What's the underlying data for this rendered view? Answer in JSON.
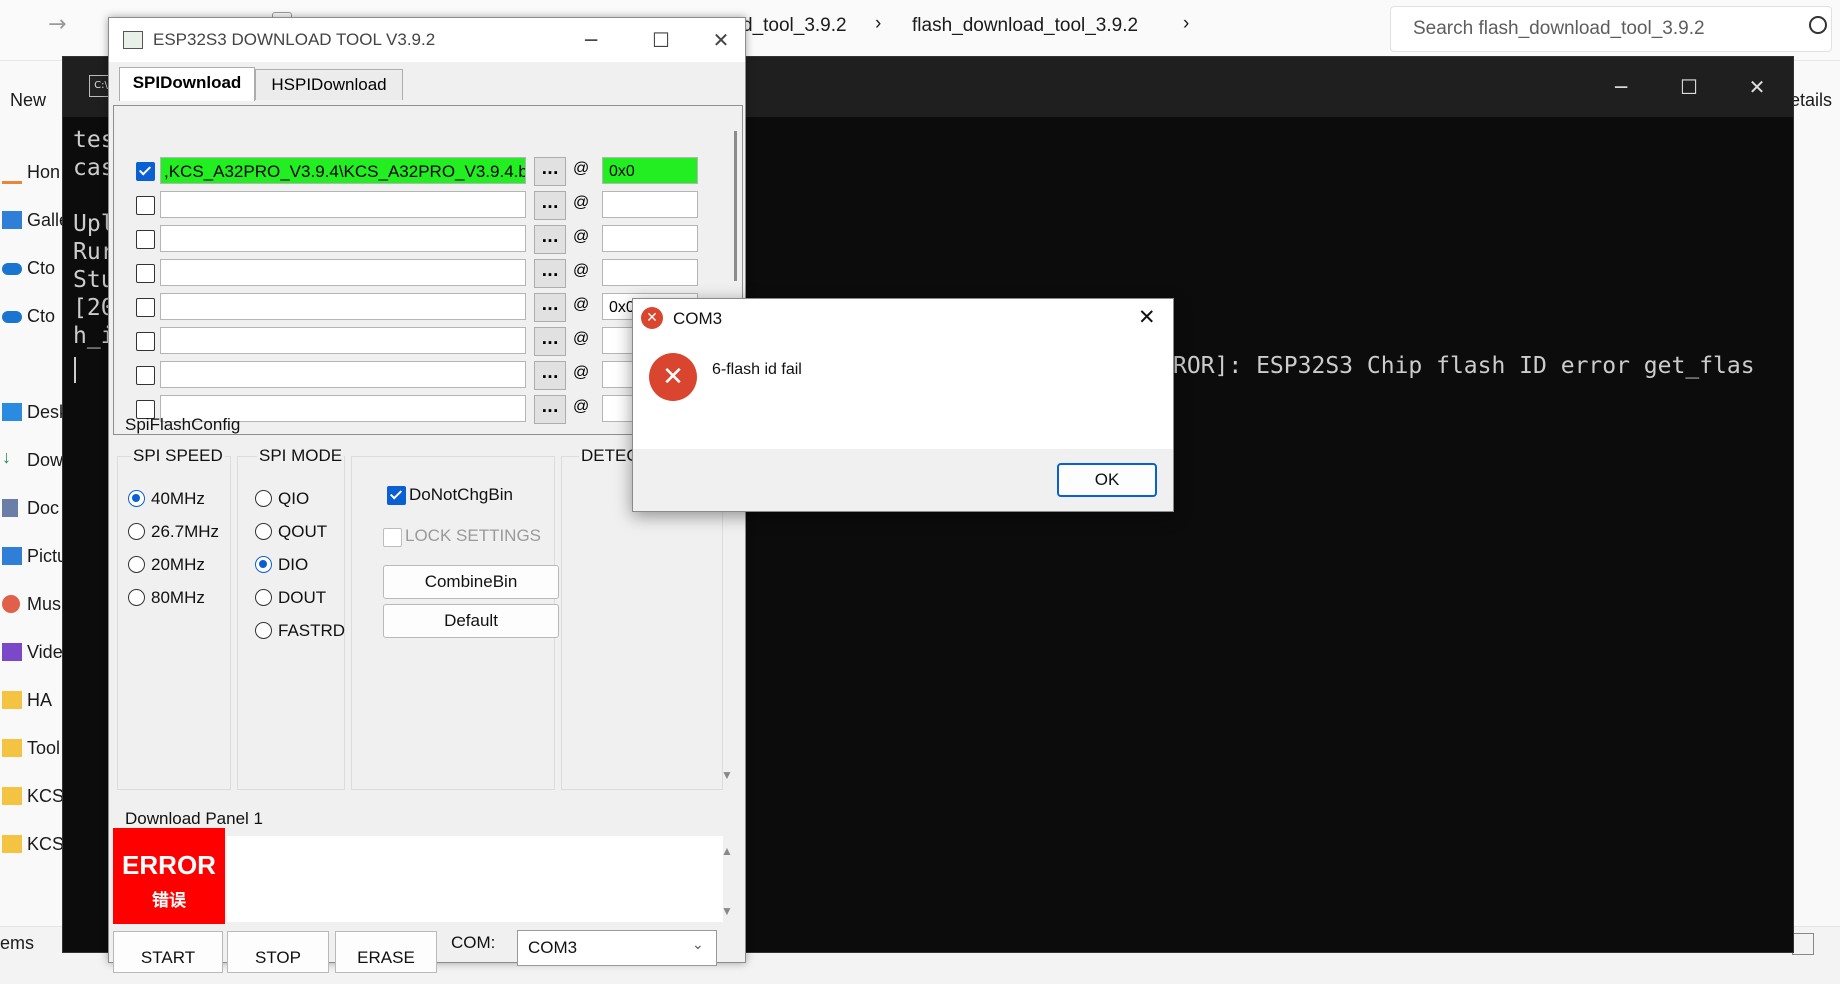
{
  "explorer": {
    "breadcrumb": [
      "d_tool_3.9.2",
      "flash_download_tool_3.9.2"
    ],
    "search_placeholder": "Search flash_download_tool_3.9.2",
    "new_label": "New",
    "details_label": "etails",
    "items_label": "ems",
    "sidebar": [
      "Hon",
      "Galle",
      "Cto",
      "Cto",
      "Desk",
      "Dow",
      "Doc",
      "Pictu",
      "Mus",
      "Vide",
      "HA",
      "Tool",
      "KCS_",
      "KCS_"
    ]
  },
  "terminal": {
    "lines": [
      "tes",
      "cas",
      "",
      "Upl",
      "Rur",
      "Stu",
      "[20",
      "h_i"
    ],
    "error_fragment": "ROR]: ESP32S3 Chip flash ID error get_flas"
  },
  "tool": {
    "title": "ESP32S3 DOWNLOAD TOOL V3.9.2",
    "tabs": [
      "SPIDownload",
      "HSPIDownload"
    ],
    "rows": [
      {
        "path": ",KCS_A32PRO_V3.9.4\\KCS_A32PRO_V3.9.4.bin",
        "addr": "0x0",
        "checked": true
      },
      {
        "path": "",
        "addr": "",
        "checked": false
      },
      {
        "path": "",
        "addr": "",
        "checked": false
      },
      {
        "path": "",
        "addr": "",
        "checked": false
      },
      {
        "path": "",
        "addr": "0x0",
        "checked": false
      },
      {
        "path": "",
        "addr": "",
        "checked": false
      },
      {
        "path": "",
        "addr": "",
        "checked": false
      },
      {
        "path": "",
        "addr": "",
        "checked": false
      }
    ],
    "browse_label": "...",
    "at_label": "@",
    "spi_config_label": "SpiFlashConfig",
    "spi_speed_label": "SPI SPEED",
    "spi_speeds": [
      "40MHz",
      "26.7MHz",
      "20MHz",
      "80MHz"
    ],
    "spi_mode_label": "SPI MODE",
    "spi_modes": [
      "QIO",
      "QOUT",
      "DIO",
      "DOUT",
      "FASTRD"
    ],
    "do_not_chg_bin": "DoNotChgBin",
    "lock_settings": "LOCK SETTINGS",
    "combine_bin": "CombineBin",
    "default": "Default",
    "detect_label": "DETEC",
    "download_panel_label": "Download Panel 1",
    "status_en": "ERROR",
    "status_cn": "错误",
    "start": "START",
    "stop": "STOP",
    "erase": "ERASE",
    "com_label": "COM:",
    "com_value": "COM3",
    "status_color": "#ff0000"
  },
  "dialog": {
    "title": "COM3",
    "message": "6-flash id fail",
    "ok": "OK"
  }
}
